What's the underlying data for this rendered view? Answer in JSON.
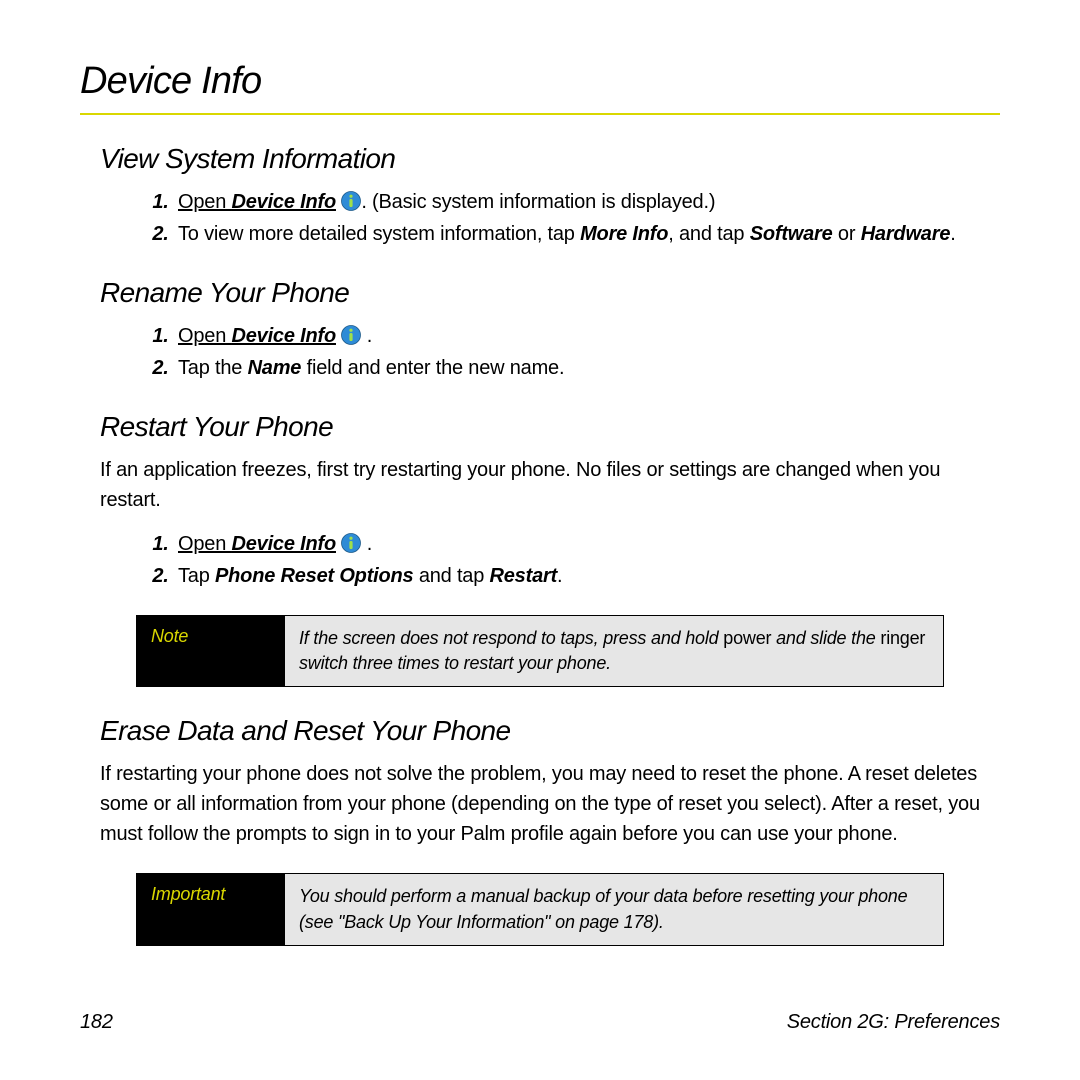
{
  "heading": "Device Info",
  "sections": {
    "view_sys": {
      "title": "View System Information",
      "steps": [
        {
          "prefix_u": "Open ",
          "cmd": "Device Info",
          "suffix": ". (Basic system information is displayed.)"
        },
        {
          "html": true,
          "text1": "To view more detailed system information, tap ",
          "b1": "More Info",
          "text2": ", and tap ",
          "b2": "Software",
          "text3": " or ",
          "b3": "Hardware",
          "text4": "."
        }
      ]
    },
    "rename": {
      "title": "Rename Your Phone",
      "steps": [
        {
          "prefix_u": "Open ",
          "cmd": "Device Info",
          "suffix": "."
        },
        {
          "tap_text1": "Tap the ",
          "tap_b1": "Name",
          "tap_text2": " field and enter the new name."
        }
      ]
    },
    "restart": {
      "title": "Restart Your Phone",
      "intro": "If an application freezes, first try restarting your phone. No files or settings are changed when you restart.",
      "steps": [
        {
          "prefix_u": "Open ",
          "cmd": "Device Info",
          "suffix": "."
        },
        {
          "tap_text1": "Tap ",
          "tap_b1": "Phone Reset Options",
          "tap_text2": " and tap ",
          "tap_b2": "Restart",
          "tap_text3": "."
        }
      ],
      "note": {
        "label": "Note",
        "text_a": "If the screen does not respond to taps, press and hold ",
        "nb1": "power",
        "text_b": " and slide the ",
        "nb2": "ringer",
        "text_c": " switch three times to restart your phone."
      }
    },
    "erase": {
      "title": "Erase Data and Reset Your Phone",
      "intro": "If restarting your phone does not solve the problem, you may need to reset the phone. A reset deletes some or all information from your phone (depending on the type of reset you select). After a reset, you must follow the prompts to sign in to your Palm profile again before you can use your phone.",
      "important": {
        "label": "Important",
        "text": "You should perform a manual backup of your data before resetting your phone (see \"Back Up Your Information\" on page 178)."
      }
    }
  },
  "footer": {
    "page": "182",
    "section": "Section 2G: Preferences"
  }
}
